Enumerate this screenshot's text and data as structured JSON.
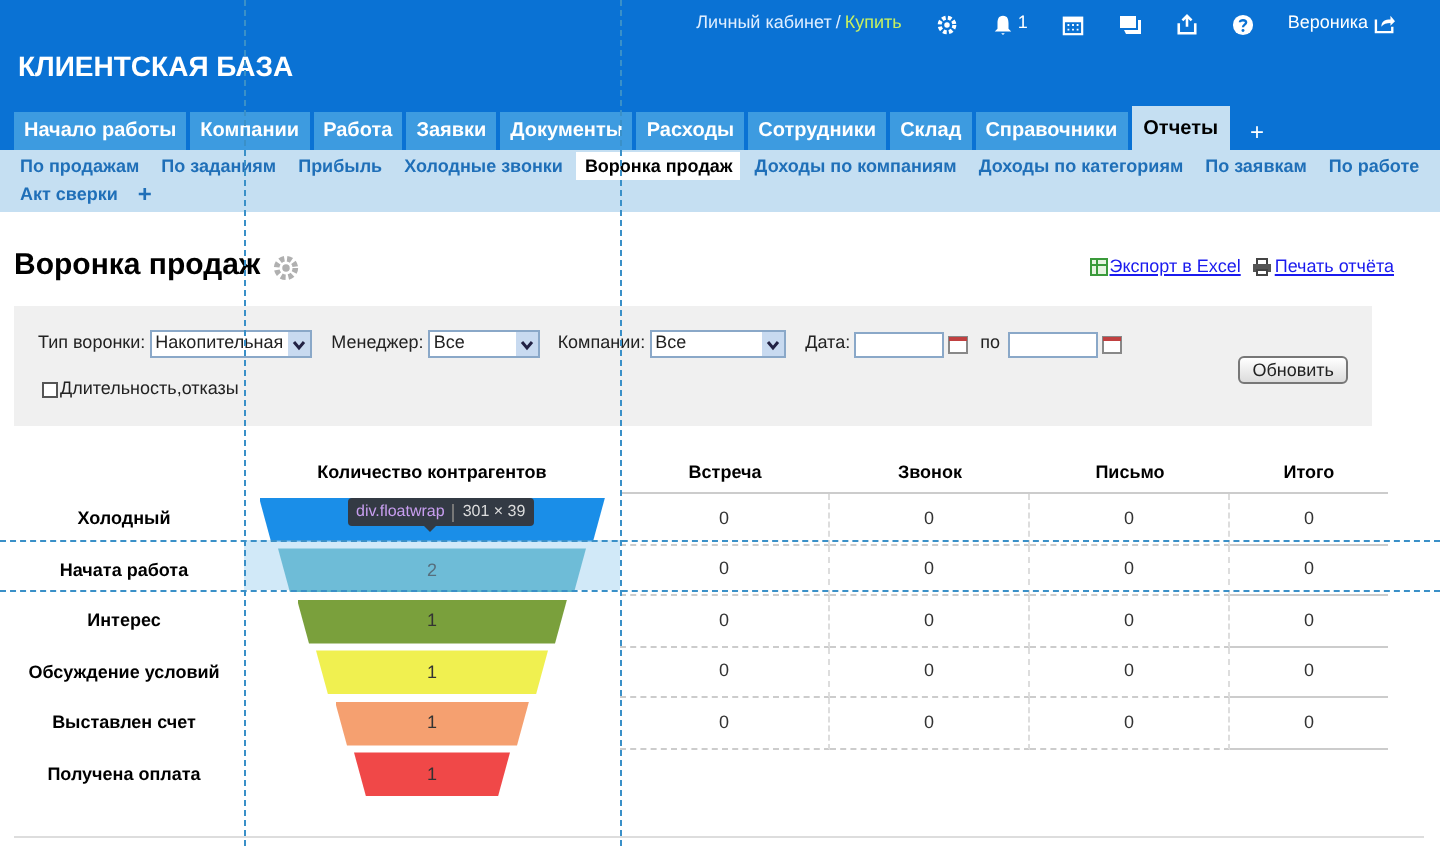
{
  "header": {
    "account_link": "Личный кабинет",
    "separator": "/",
    "buy_link": "Купить",
    "notifications_count": "1",
    "user": "Вероника",
    "app_title": "КЛИЕНТСКАЯ БАЗА"
  },
  "tabs": [
    {
      "label": "Начало работы",
      "selected": false
    },
    {
      "label": "Компании",
      "selected": false
    },
    {
      "label": "Работа",
      "selected": false
    },
    {
      "label": "Заявки",
      "selected": false
    },
    {
      "label": "Документы",
      "selected": false
    },
    {
      "label": "Расходы",
      "selected": false
    },
    {
      "label": "Сотрудники",
      "selected": false
    },
    {
      "label": "Склад",
      "selected": false
    },
    {
      "label": "Справочники",
      "selected": false
    },
    {
      "label": "Отчеты",
      "selected": true
    }
  ],
  "tab_add": "+",
  "subtabs": [
    {
      "label": "По продажам",
      "selected": false
    },
    {
      "label": "По заданиям",
      "selected": false
    },
    {
      "label": "Прибыль",
      "selected": false
    },
    {
      "label": "Холодные звонки",
      "selected": false
    },
    {
      "label": "Воронка продаж",
      "selected": true
    },
    {
      "label": "Доходы по компаниям",
      "selected": false
    },
    {
      "label": "Доходы по категориям",
      "selected": false
    },
    {
      "label": "По заявкам",
      "selected": false
    },
    {
      "label": "По работе",
      "selected": false
    },
    {
      "label": "Акт сверки",
      "selected": false
    }
  ],
  "subtab_add": "+",
  "page_title": "Воронка продаж",
  "export_link": "Экспорт в Excel",
  "print_link": "Печать отчёта",
  "filters": {
    "funnel_type_label": "Тип воронки:",
    "funnel_type": "Накопительная",
    "manager_label": "Менеджер:",
    "manager": "Все",
    "companies_label": "Компании:",
    "companies": "Все",
    "date_label": "Дата:",
    "date_to_label": "по",
    "duration_label": "Длительность,отказы",
    "duration_checked": false,
    "refresh_button": "Обновить"
  },
  "table": {
    "columns": [
      "",
      "Количество контрагентов",
      "Встреча",
      "Звонок",
      "Письмо",
      "Итого"
    ],
    "rows": [
      {
        "color": "#1a8ee8",
        "cells": [
          "Холодный",
          "",
          "0",
          "0",
          "0",
          "0"
        ]
      },
      {
        "color": "#5bb5c8",
        "cells": [
          "Начата работа",
          "2",
          "0",
          "0",
          "0",
          "0"
        ]
      },
      {
        "color": "#7aa03c",
        "cells": [
          "Интерес",
          "1",
          "0",
          "0",
          "0",
          "0"
        ]
      },
      {
        "color": "#f0f050",
        "cells": [
          "Обсуждение условий",
          "1",
          "0",
          "0",
          "0",
          "0"
        ]
      },
      {
        "color": "#f5a070",
        "cells": [
          "Выставлен счет",
          "1",
          "0",
          "0",
          "0",
          "0"
        ]
      },
      {
        "color": "#f04848",
        "cells": [
          "Получена оплата",
          "1"
        ]
      }
    ]
  },
  "devtools_tooltip": {
    "selector": "div.floatwrap",
    "size": "301 × 39"
  }
}
